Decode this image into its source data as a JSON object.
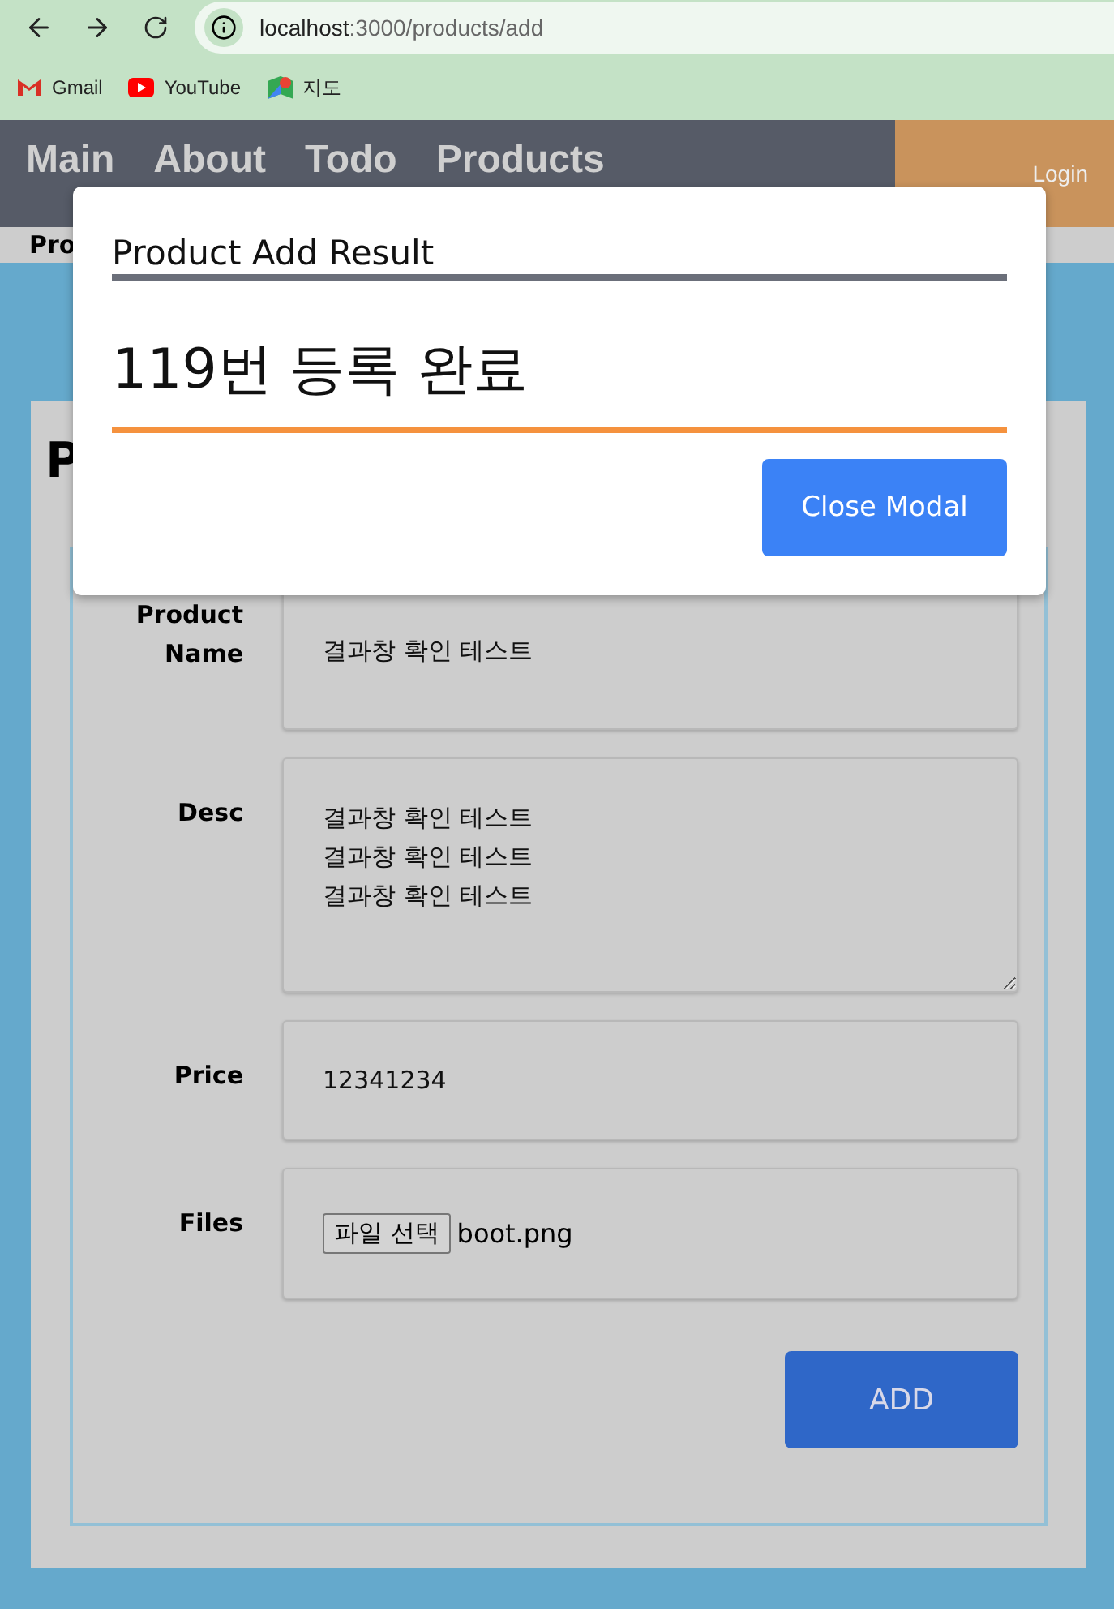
{
  "browser": {
    "url_host": "localhost",
    "url_rest": ":3000/products/add",
    "bookmarks": [
      {
        "label": "Gmail",
        "kind": "gmail"
      },
      {
        "label": "YouTube",
        "kind": "youtube"
      },
      {
        "label": "지도",
        "kind": "maps"
      }
    ]
  },
  "nav": {
    "links": [
      "Main",
      "About",
      "Todo",
      "Products"
    ],
    "login": "Login"
  },
  "subbar": {
    "label": "Pro"
  },
  "card": {
    "title": "P",
    "fields": [
      {
        "label": "Product Name",
        "kind": "input",
        "value": "결과창 확인 테스트"
      },
      {
        "label": "Desc",
        "kind": "textarea",
        "lines": [
          "결과창 확인 테스트",
          "결과창 확인 테스트",
          "결과창 확인 테스트"
        ]
      },
      {
        "label": "Price",
        "kind": "input",
        "value": "12341234"
      },
      {
        "label": "Files",
        "kind": "file",
        "button": "파일 선택",
        "value": "boot.png"
      }
    ],
    "submit": "ADD"
  },
  "modal": {
    "title": "Product Add Result",
    "message": "119번 등록 완료",
    "button": "Close Modal"
  }
}
